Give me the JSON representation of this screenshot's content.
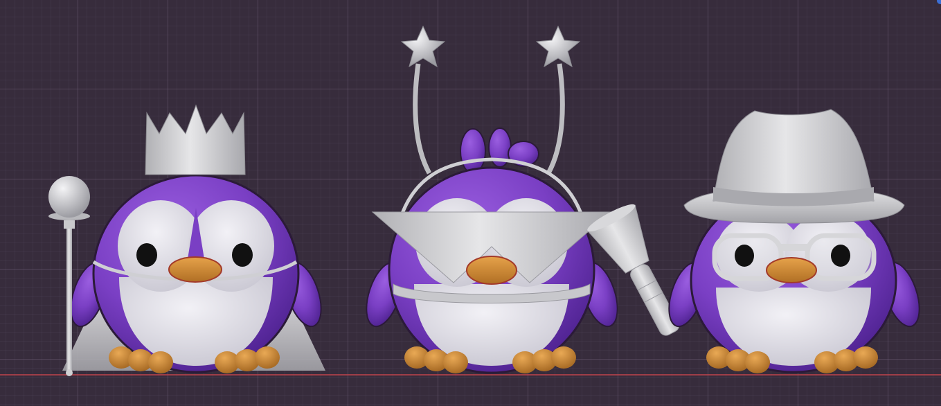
{
  "viewport": {
    "background_color": "#372c3c",
    "grid_color": "#826e8c",
    "ground_line_color": "#c0444c"
  },
  "colors": {
    "body_purple": "#7a3fc4",
    "body_purple_dark": "#4e2290",
    "belly_white": "#e2e1e8",
    "beak_orange": "#d08a3a",
    "feet_orange": "#c98736",
    "prop_gray": "#c4c4c6",
    "eye_black": "#111111"
  },
  "characters": [
    {
      "name": "penguin-king",
      "props": [
        "crown",
        "scepter",
        "cape",
        "collar"
      ]
    },
    {
      "name": "penguin-alien",
      "props": [
        "star-antenna-headband",
        "pointed-collar",
        "belt",
        "flashlight"
      ]
    },
    {
      "name": "penguin-detective",
      "props": [
        "fedora-hat",
        "glasses"
      ]
    }
  ]
}
